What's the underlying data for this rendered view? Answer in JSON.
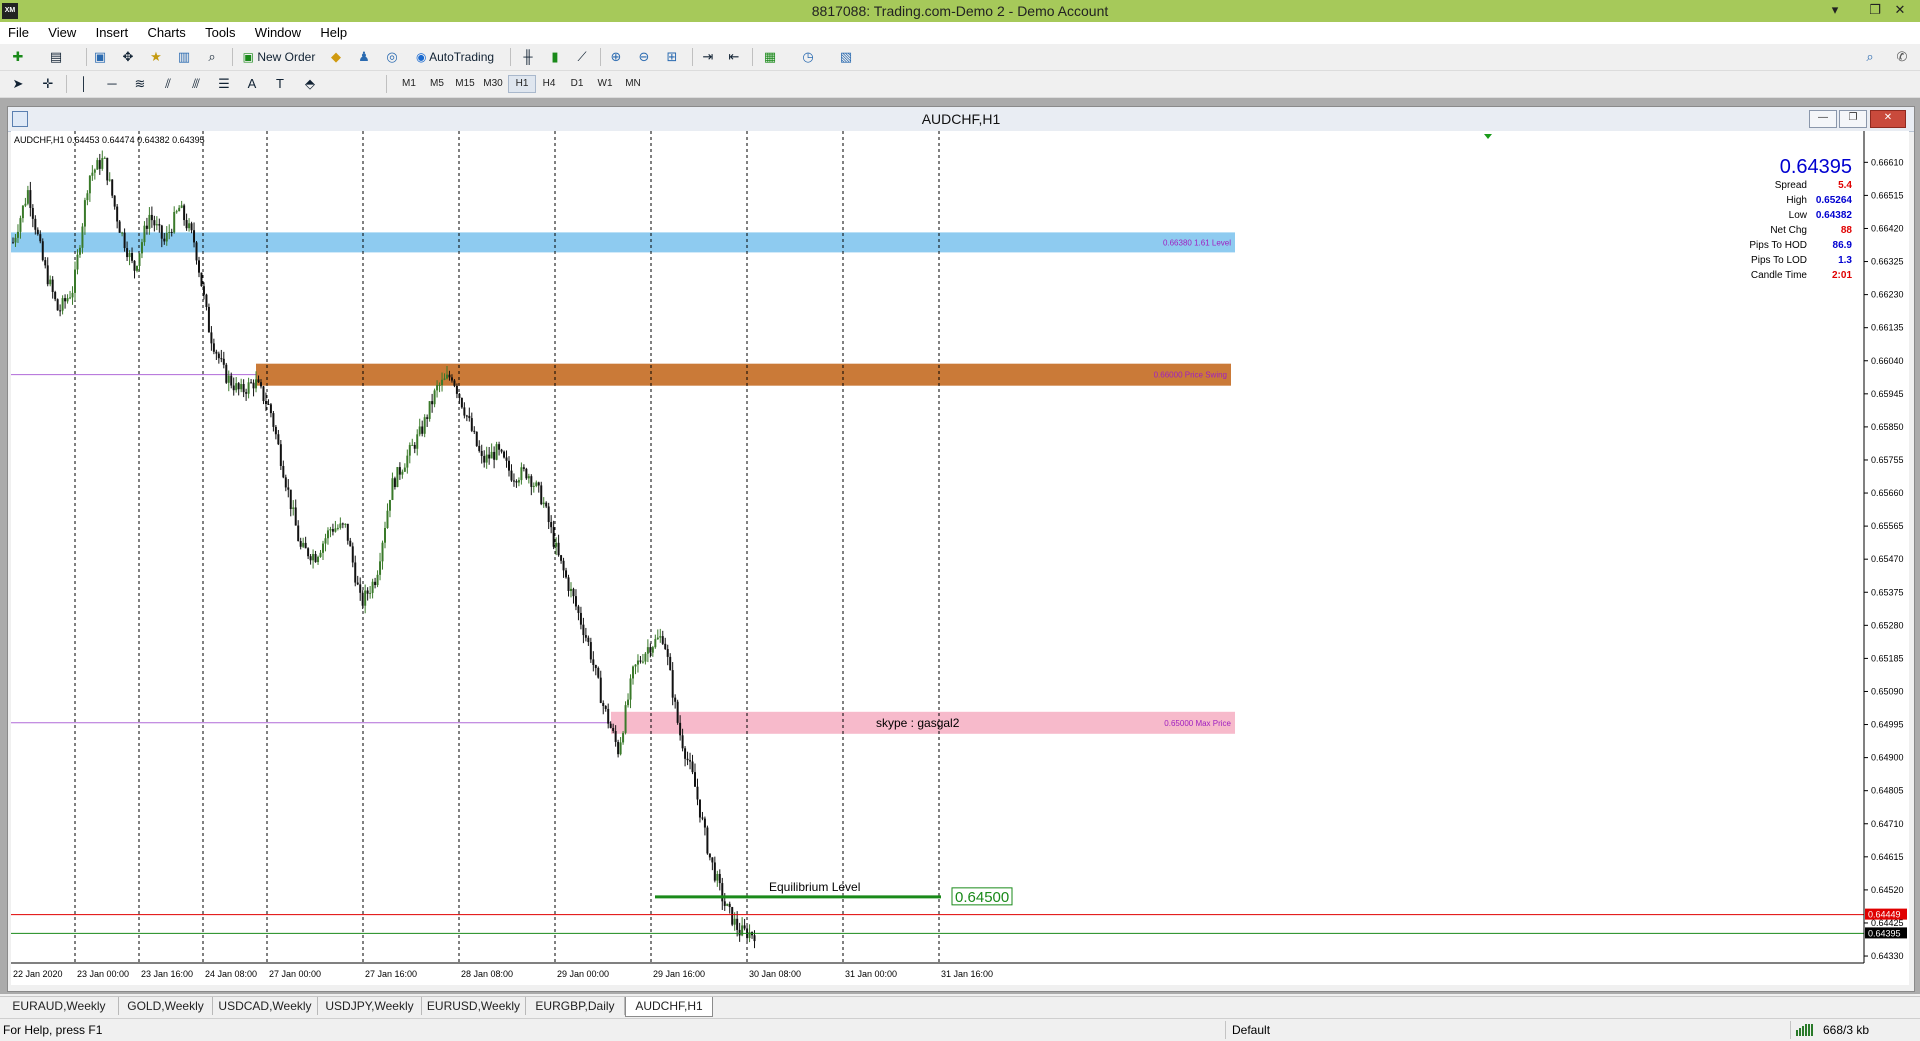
{
  "window": {
    "title": "8817088: Trading.com-Demo 2 - Demo Account",
    "app_icon": "XM",
    "minimize": "▾",
    "restore": "❐",
    "close": "✕"
  },
  "menu": [
    "File",
    "View",
    "Insert",
    "Charts",
    "Tools",
    "Window",
    "Help"
  ],
  "toolbar": {
    "new_order": "New Order",
    "autotrading": "AutoTrading"
  },
  "timeframes": [
    "M1",
    "M5",
    "M15",
    "M30",
    "H1",
    "H4",
    "D1",
    "W1",
    "MN"
  ],
  "active_timeframe": "H1",
  "chart_window": {
    "title": "AUDCHF,H1",
    "minimize": "—",
    "restore": "❐",
    "close": "✕"
  },
  "chart_data": {
    "type": "candlestick",
    "symbol_info": "AUDCHF,H1  0.64453 0.64474 0.64382 0.64395",
    "y_ticks": [
      "0.66610",
      "0.66515",
      "0.66420",
      "0.66325",
      "0.66230",
      "0.66135",
      "0.66040",
      "0.65945",
      "0.65850",
      "0.65755",
      "0.65660",
      "0.65565",
      "0.65470",
      "0.65375",
      "0.65280",
      "0.65185",
      "0.65090",
      "0.64995",
      "0.64900",
      "0.64805",
      "0.64710",
      "0.64615",
      "0.64520",
      "0.64425",
      "0.64330"
    ],
    "ylim": [
      0.6431,
      0.667
    ],
    "x_ticks": [
      "22 Jan 2020",
      "23 Jan 00:00",
      "23 Jan 16:00",
      "24 Jan 08:00",
      "27 Jan 00:00",
      "27 Jan 16:00",
      "28 Jan 08:00",
      "29 Jan 00:00",
      "29 Jan 16:00",
      "30 Jan 08:00",
      "31 Jan 00:00",
      "31 Jan 16:00"
    ],
    "path": [
      0.6638,
      0.6653,
      0.6632,
      0.6618,
      0.6625,
      0.6657,
      0.6662,
      0.6643,
      0.663,
      0.6646,
      0.6638,
      0.6648,
      0.6638,
      0.6612,
      0.66,
      0.6595,
      0.6598,
      0.659,
      0.657,
      0.655,
      0.6548,
      0.6556,
      0.6556,
      0.6534,
      0.6542,
      0.6568,
      0.6576,
      0.6584,
      0.6596,
      0.66,
      0.6588,
      0.6575,
      0.6578,
      0.6571,
      0.6572,
      0.6564,
      0.6548,
      0.6536,
      0.6523,
      0.6505,
      0.6492,
      0.6515,
      0.6522,
      0.6525,
      0.6498,
      0.6483,
      0.6462,
      0.6448,
      0.644,
      0.64395
    ],
    "zones": [
      {
        "label": "0.66380  1.61 Level",
        "price": 0.6638,
        "color": "#88c8ef"
      },
      {
        "label": "0.66000  Price Swing",
        "price": 0.66,
        "color": "#c7732d"
      },
      {
        "label": "0.65000   Max Price",
        "price": 0.65,
        "color": "#f7b6c8"
      }
    ],
    "annotations": {
      "skype": "skype : gasgal2",
      "equilibrium": "Equilibrium Level",
      "equilibrium_price": "0.64500"
    },
    "price_labels": {
      "red": "0.64449",
      "current": "0.64395",
      "hidden": "0.64425"
    },
    "info_panel": {
      "price": "0.64395",
      "rows": [
        {
          "label": "Spread",
          "value": "5.4",
          "color": "#e00000"
        },
        {
          "label": "High",
          "value": "0.65264",
          "color": "#0000d0"
        },
        {
          "label": "Low",
          "value": "0.64382",
          "color": "#0000d0"
        },
        {
          "label": "Net Chg",
          "value": "88",
          "color": "#e00000"
        },
        {
          "label": "Pips To HOD",
          "value": "86.9",
          "color": "#0000d0"
        },
        {
          "label": "Pips To LOD",
          "value": "1.3",
          "color": "#0000d0"
        },
        {
          "label": "Candle Time",
          "value": "2:01",
          "color": "#e00000"
        }
      ]
    },
    "colors": {
      "bull": "#3a7a2a",
      "bear": "#111111",
      "red_line": "#e00000",
      "green_line": "#1a8a1a",
      "purple_line": "#b06ad8"
    }
  },
  "tabs": [
    "EURAUD,Weekly",
    "GOLD,Weekly",
    "USDCAD,Weekly",
    "USDJPY,Weekly",
    "EURUSD,Weekly",
    "EURGBP,Daily",
    "AUDCHF,H1"
  ],
  "active_tab": "AUDCHF,H1",
  "status": {
    "help": "For Help, press F1",
    "profile": "Default",
    "traffic": "668/3 kb"
  }
}
